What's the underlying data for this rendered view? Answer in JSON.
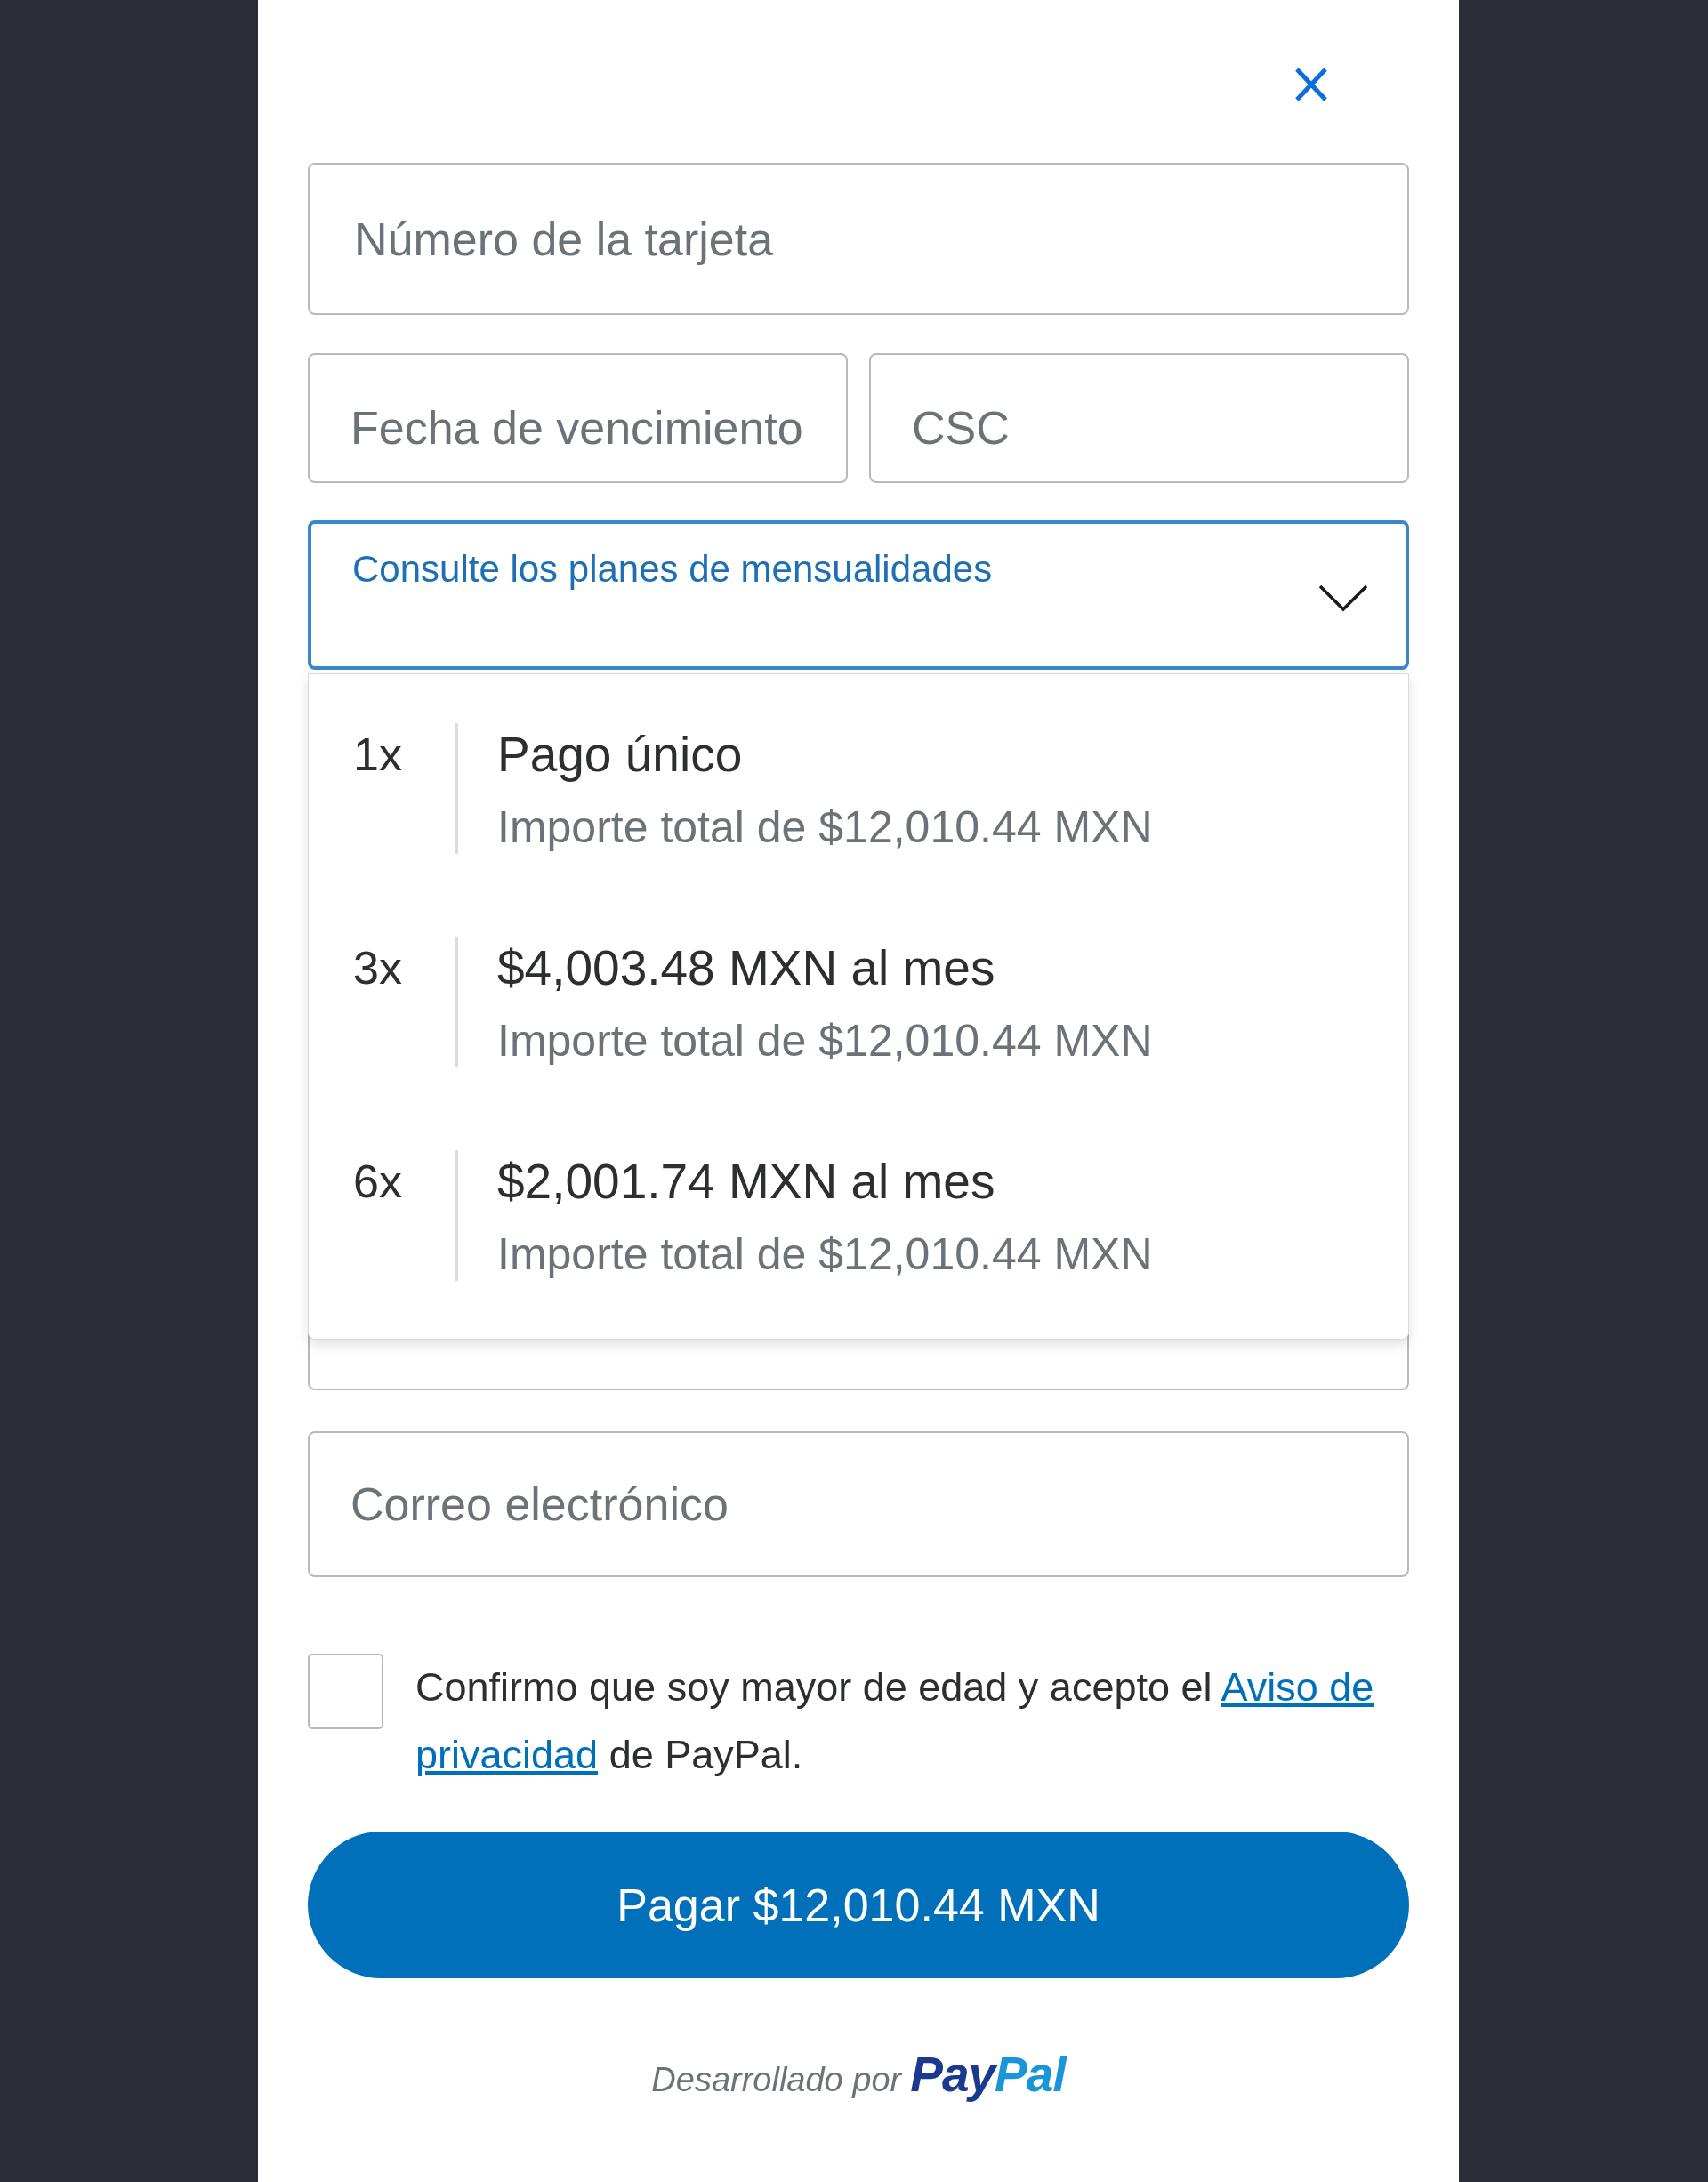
{
  "card_form": {
    "card_number": {
      "placeholder": "Número de la tarjeta"
    },
    "expiry": {
      "placeholder": "Fecha de vencimiento"
    },
    "csc": {
      "placeholder": "CSC"
    },
    "installments": {
      "label": "Consulte los planes de mensualidades",
      "expanded": true,
      "options": [
        {
          "count": "1x",
          "title": "Pago único",
          "total": "Importe total de $12,010.44 MXN",
          "selected": false
        },
        {
          "count": "3x",
          "title": "$4,003.48 MXN al mes",
          "total": "Importe total de $12,010.44 MXN",
          "selected": false
        },
        {
          "count": "6x",
          "title": "$2,001.74 MXN al mes",
          "total": "Importe total de $12,010.44 MXN",
          "selected": false
        }
      ]
    },
    "email": {
      "placeholder": "Correo electrónico"
    }
  },
  "consent": {
    "checked": false,
    "text_before": "Confirmo que soy mayor de edad y acepto el",
    "link": [
      "Aviso de",
      "privacidad"
    ],
    "text_after": "de PayPal."
  },
  "pay_button": {
    "label": "Pagar $12,010.44 MXN"
  },
  "footer": {
    "text": "Desarrollado por",
    "logo": [
      "Pay",
      "Pal"
    ]
  }
}
